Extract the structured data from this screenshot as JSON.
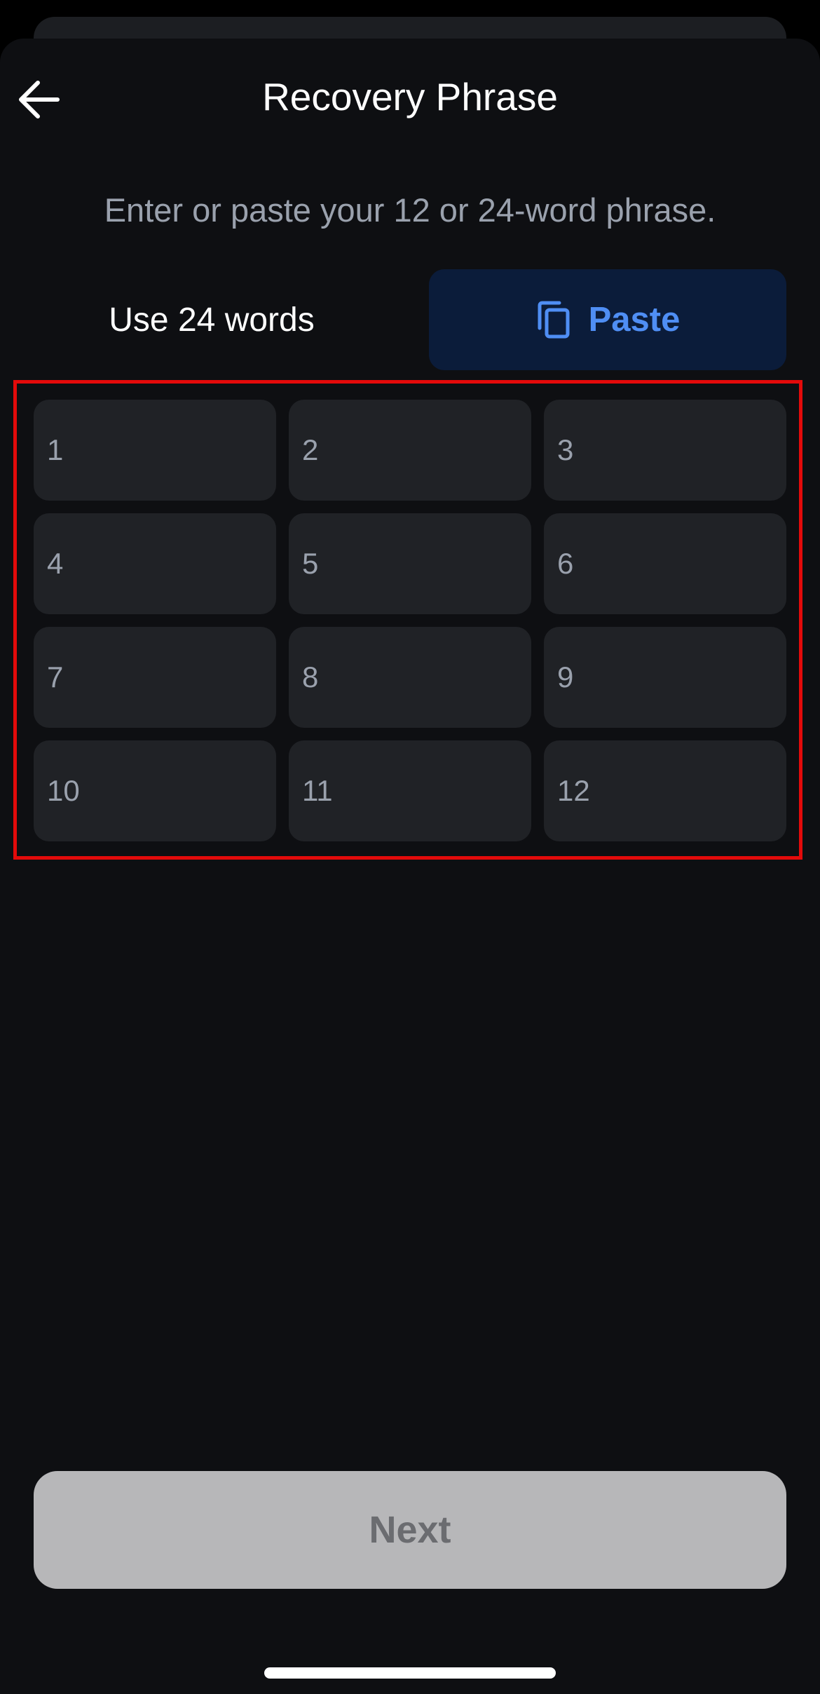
{
  "header": {
    "title": "Recovery Phrase",
    "back_icon": "arrow-left-icon"
  },
  "instruction": "Enter or paste your 12 or 24-word phrase.",
  "actions": {
    "use_24_label": "Use 24 words",
    "paste_label": "Paste",
    "paste_icon": "copy-icon"
  },
  "word_fields": [
    "1",
    "2",
    "3",
    "4",
    "5",
    "6",
    "7",
    "8",
    "9",
    "10",
    "11",
    "12"
  ],
  "footer": {
    "next_label": "Next"
  },
  "colors": {
    "background": "#0e0f12",
    "field_bg": "#202226",
    "accent": "#4f8ef4",
    "paste_bg": "#0b1c3a",
    "highlight_border": "#e30a0a",
    "next_disabled_bg": "#b7b7b9"
  }
}
